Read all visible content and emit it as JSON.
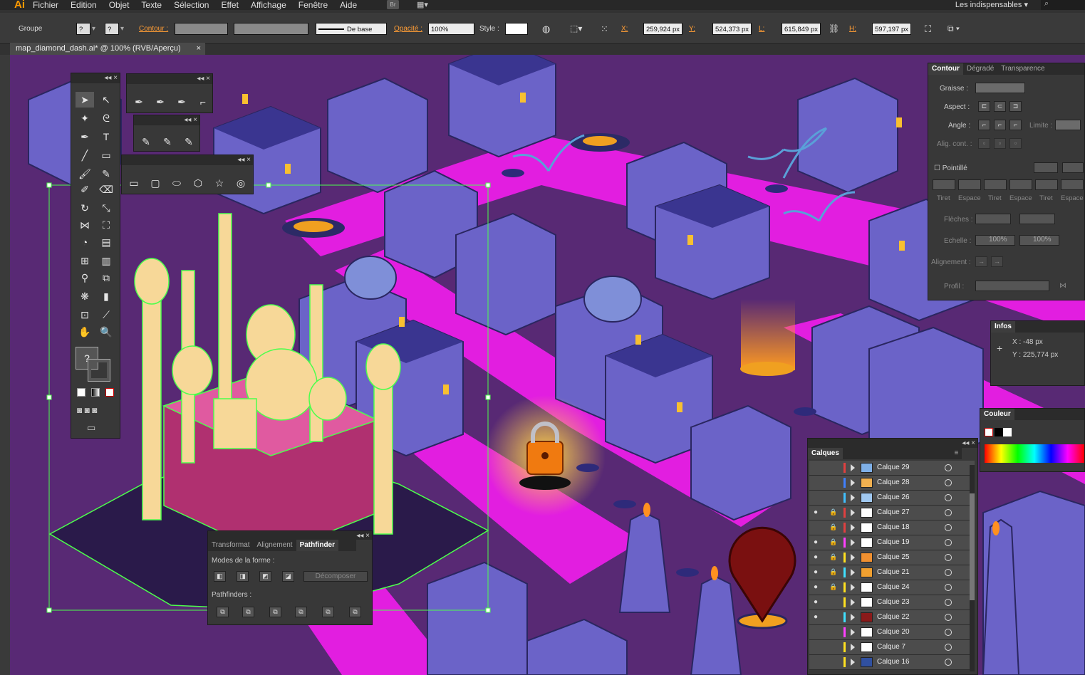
{
  "menubar": {
    "logo": "Ai",
    "items": [
      "Fichier",
      "Edition",
      "Objet",
      "Texte",
      "Sélection",
      "Effet",
      "Affichage",
      "Fenêtre",
      "Aide"
    ],
    "bridge": "Br",
    "workspace": "Les indispensables"
  },
  "control": {
    "selection": "Groupe",
    "stroke_label": "Contour :",
    "stroke_style": "De base",
    "opacity_label": "Opacité :",
    "opacity": "100%",
    "style_label": "Style :",
    "x_label": "X:",
    "x": "259,924 px",
    "y_label": "Y:",
    "y": "524,373 px",
    "w_label": "L:",
    "w": "615,849 px",
    "h_label": "H:",
    "h": "597,197 px",
    "q1": "?",
    "q2": "?"
  },
  "doc": {
    "tab": "map_diamond_dash.ai* @ 100% (RVB/Aperçu)"
  },
  "contour": {
    "tabs": [
      "Contour",
      "Dégradé",
      "Transparence"
    ],
    "weight": "Graisse :",
    "cap": "Aspect :",
    "corner": "Angle :",
    "limit": "Limite :",
    "align": "Alig. cont. :",
    "dashed": "Pointillé",
    "dash_labels": [
      "Tiret",
      "Espace",
      "Tiret",
      "Espace",
      "Tiret",
      "Espace"
    ],
    "arrows": "Flèches :",
    "scale": "Echelle :",
    "scale1": "100%",
    "scale2": "100%",
    "alignment": "Alignement :",
    "profile": "Profil :"
  },
  "infos": {
    "title": "Infos",
    "x": "X :  -48 px",
    "y": "Y :  225,774 px"
  },
  "couleur": {
    "title": "Couleur"
  },
  "calques": {
    "title": "Calques",
    "rows": [
      {
        "name": "Calque 29",
        "eye": "",
        "lock": "",
        "color": "#e04040",
        "thumb": "#7fb0e8"
      },
      {
        "name": "Calque 28",
        "eye": "",
        "lock": "",
        "color": "#4080ff",
        "thumb": "#f0b050"
      },
      {
        "name": "Calque 26",
        "eye": "",
        "lock": "",
        "color": "#40c0ff",
        "thumb": "#a0c8f0"
      },
      {
        "name": "Calque 27",
        "eye": "●",
        "lock": "🔒",
        "color": "#e04040",
        "thumb": "#ffffff"
      },
      {
        "name": "Calque 18",
        "eye": "",
        "lock": "🔒",
        "color": "#e04040",
        "thumb": "#ffffff"
      },
      {
        "name": "Calque 19",
        "eye": "●",
        "lock": "🔒",
        "color": "#ff40ff",
        "thumb": "#ffffff"
      },
      {
        "name": "Calque 25",
        "eye": "●",
        "lock": "🔒",
        "color": "#ffe020",
        "thumb": "#f09030"
      },
      {
        "name": "Calque 21",
        "eye": "●",
        "lock": "🔒",
        "color": "#40e0ff",
        "thumb": "#f0a030"
      },
      {
        "name": "Calque 24",
        "eye": "●",
        "lock": "🔒",
        "color": "#ffe020",
        "thumb": "#ffffff"
      },
      {
        "name": "Calque 23",
        "eye": "●",
        "lock": "",
        "color": "#ffe020",
        "thumb": "#ffffff"
      },
      {
        "name": "Calque 22",
        "eye": "●",
        "lock": "",
        "color": "#40e0ff",
        "thumb": "#8a1a1a"
      },
      {
        "name": "Calque 20",
        "eye": "",
        "lock": "",
        "color": "#ff40ff",
        "thumb": "#ffffff"
      },
      {
        "name": "Calque 7",
        "eye": "",
        "lock": "",
        "color": "#ffe020",
        "thumb": "#ffffff"
      },
      {
        "name": "Calque 16",
        "eye": "",
        "lock": "",
        "color": "#ffe020",
        "thumb": "#3050a0"
      }
    ]
  },
  "pathfinder": {
    "tabs": [
      "Transformat",
      "Alignement",
      "Pathfinder"
    ],
    "modes": "Modes de la forme :",
    "expand": "Décomposer",
    "finders": "Pathfinders :"
  }
}
